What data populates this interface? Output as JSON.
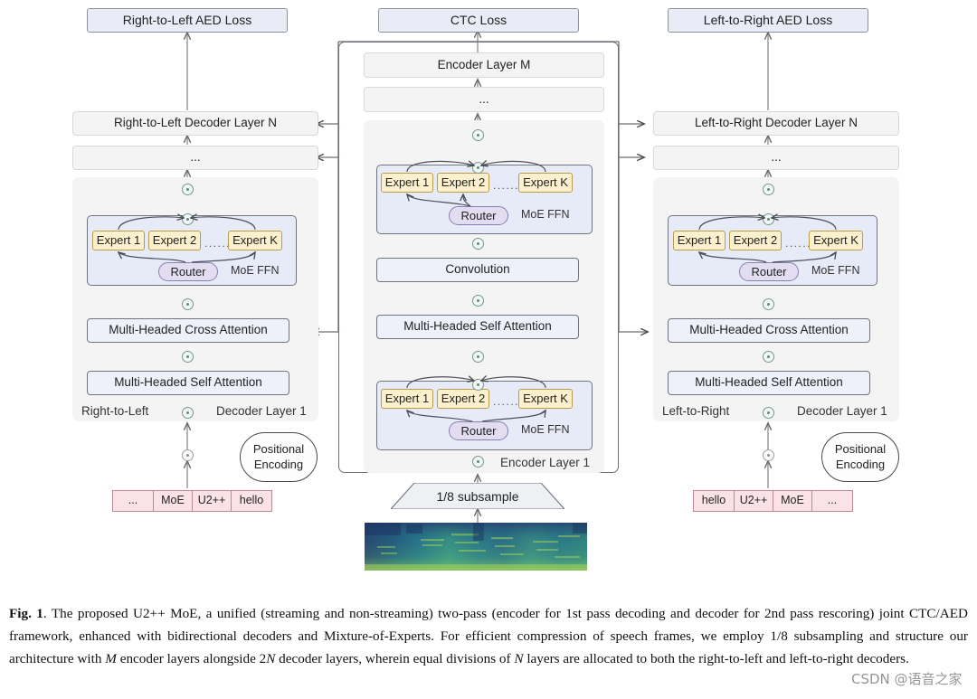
{
  "figure": {
    "id": "Fig. 1",
    "watermark": "CSDN @语音之家",
    "caption_parts": {
      "label": "Fig. 1",
      "text1": ". The proposed U2++ MoE, a unified (streaming and non-streaming) two-pass (encoder for 1st pass decoding and decoder for 2nd pass rescoring) joint CTC/AED framework, enhanced with bidirectional decoders and Mixture-of-Experts. For efficient compression of speech frames, we employ 1/8 subsampling and structure our architecture with ",
      "m": "M",
      "text2": " encoder layers alongside 2",
      "n1": "N",
      "text3": " decoder layers, wherein equal divisions of ",
      "n2": "N",
      "text4": " layers are allocated to both the right-to-left and left-to-right decoders."
    }
  },
  "losses": {
    "right_to_left": "Right-to-Left AED Loss",
    "ctc": "CTC Loss",
    "left_to_right": "Left-to-Right AED Loss"
  },
  "encoder": {
    "top_layer": "Encoder Layer M",
    "ellipsis": "...",
    "bottom_layer_label": "Encoder Layer 1",
    "convolution": "Convolution",
    "self_attention": "Multi-Headed Self Attention",
    "subsample": "1/8 subsample",
    "moe": {
      "experts": [
        "Expert 1",
        "Expert 2",
        "Expert K"
      ],
      "expert_ellipsis": "......",
      "router": "Router",
      "label": "MoE FFN"
    }
  },
  "decoder_left": {
    "top_layer": "Right-to-Left Decoder Layer N",
    "ellipsis": "...",
    "direction_label": "Right-to-Left",
    "bottom_layer_label": "Decoder Layer 1",
    "cross_attention": "Multi-Headed Cross Attention",
    "self_attention": "Multi-Headed Self Attention",
    "positional_encoding": [
      "Positional",
      "Encoding"
    ],
    "tokens": [
      "...",
      "MoE",
      "U2++",
      "hello"
    ],
    "moe": {
      "experts": [
        "Expert 1",
        "Expert 2",
        "Expert K"
      ],
      "expert_ellipsis": "......",
      "router": "Router",
      "label": "MoE FFN"
    }
  },
  "decoder_right": {
    "top_layer": "Left-to-Right Decoder Layer N",
    "ellipsis": "...",
    "direction_label": "Left-to-Right",
    "bottom_layer_label": "Decoder Layer 1",
    "cross_attention": "Multi-Headed Cross Attention",
    "self_attention": "Multi-Headed Self Attention",
    "positional_encoding": [
      "Positional",
      "Encoding"
    ],
    "tokens": [
      "hello",
      "U2++",
      "MoE",
      "..."
    ],
    "moe": {
      "experts": [
        "Expert 1",
        "Expert 2",
        "Expert K"
      ],
      "expert_ellipsis": "......",
      "router": "Router",
      "label": "MoE FFN"
    }
  },
  "colors": {
    "expert_fill": "#fdf1cd",
    "router_fill": "#e3ddf2",
    "moe_panel_fill": "#e7eaf7",
    "attention_fill": "#eef1fa",
    "loss_fill": "#e9ecf7",
    "token_fill": "#fbe2e6",
    "panel_fill": "#f4f4f5"
  }
}
